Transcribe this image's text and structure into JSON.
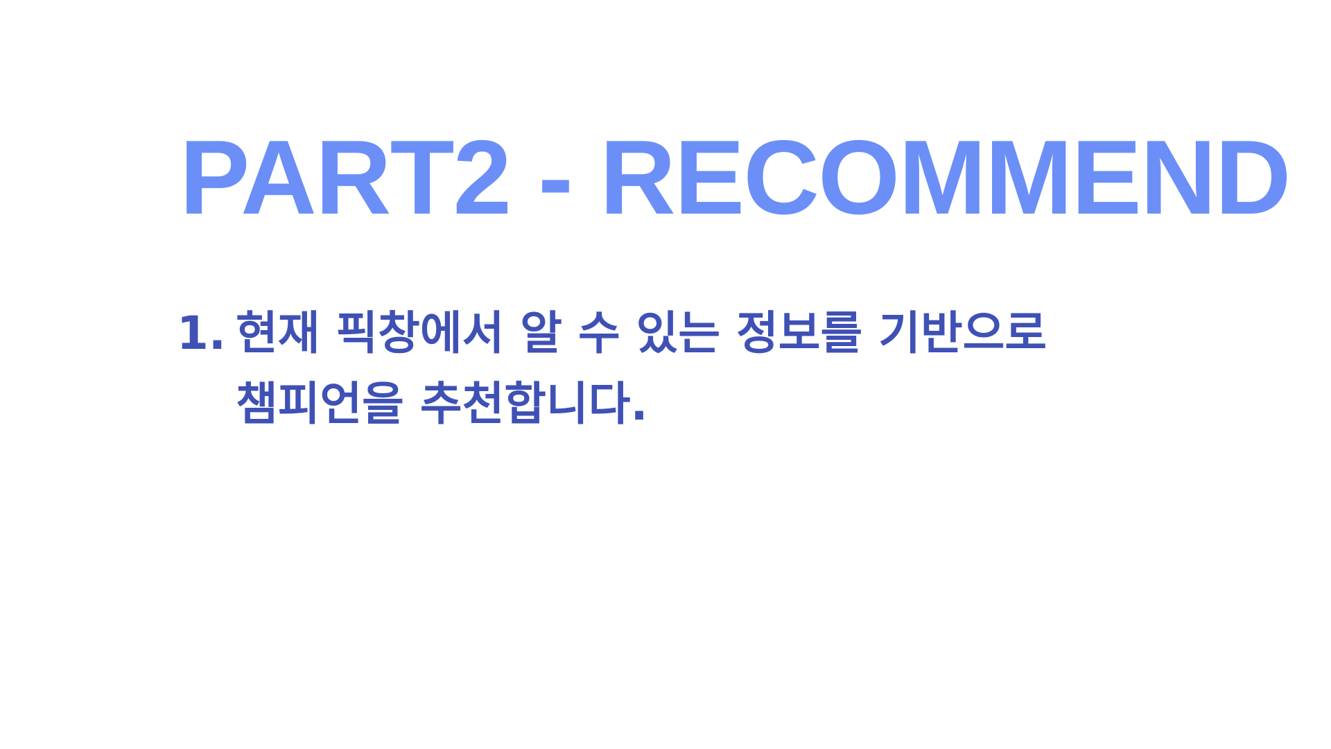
{
  "slide": {
    "title": "PART2 - RECOMMEND",
    "items": [
      {
        "number": "1.",
        "text": "현재 픽창에서 알 수 있는 정보를 기반으로 챔피언을 추천합니다."
      }
    ]
  },
  "colors": {
    "background": "#ffffff",
    "title": "#6b8ff7",
    "body_text": "#3f51b5"
  }
}
